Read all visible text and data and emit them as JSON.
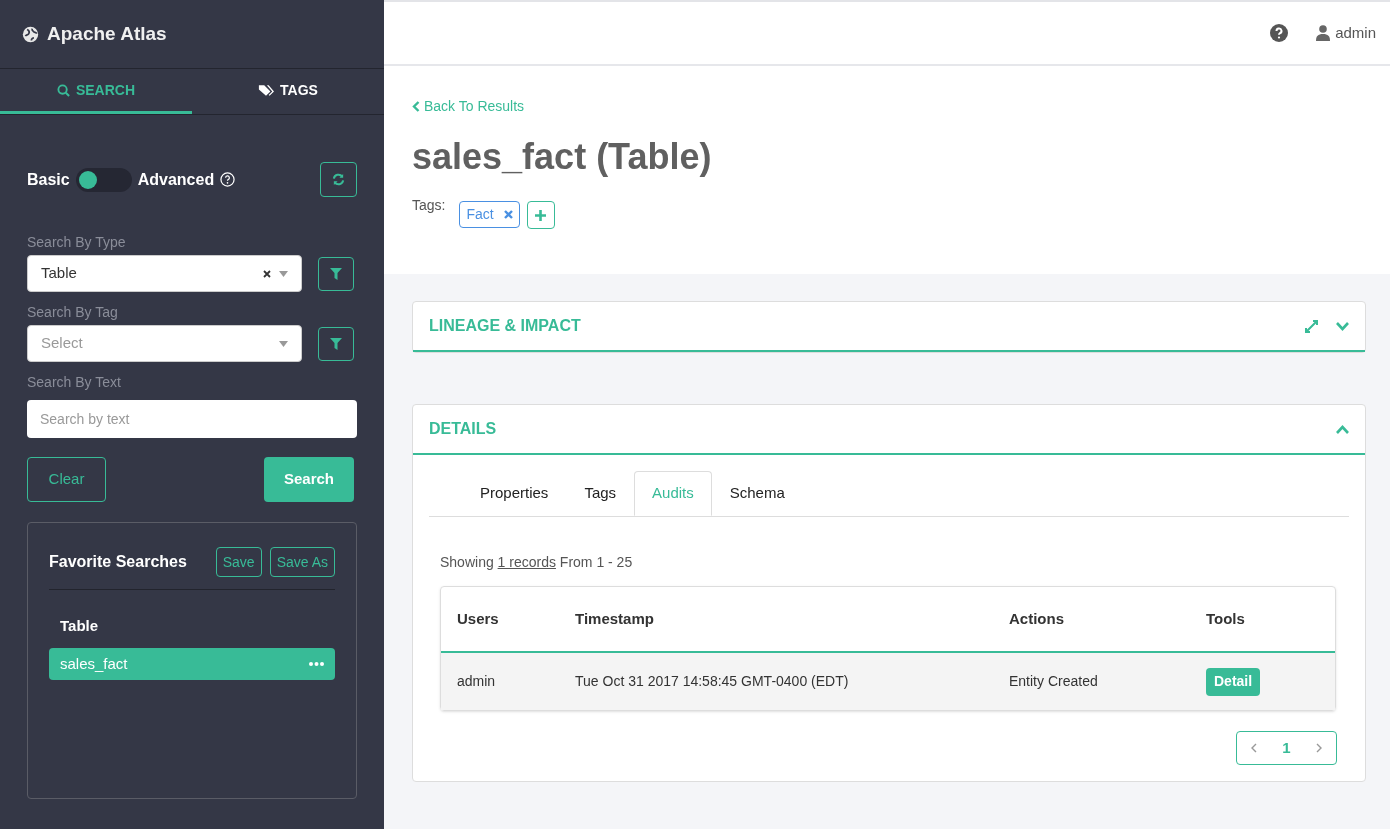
{
  "app": {
    "title": "Apache Atlas"
  },
  "side_tabs": [
    {
      "label": "SEARCH",
      "selected": true
    },
    {
      "label": "TAGS",
      "selected": false
    }
  ],
  "search_mode": {
    "left_label": "Basic",
    "right_label": "Advanced",
    "on": false
  },
  "search_by_type": {
    "label": "Search By Type",
    "value": "Table"
  },
  "search_by_tag": {
    "label": "Search By Tag",
    "placeholder": "Select"
  },
  "search_by_text": {
    "label": "Search By Text",
    "placeholder": "Search by text"
  },
  "actions": {
    "clear": "Clear",
    "search": "Search"
  },
  "favorites": {
    "title": "Favorite Searches",
    "buttons": [
      "Save",
      "Save As"
    ],
    "items": [
      {
        "label": "Table",
        "selected": false
      },
      {
        "label": "sales_fact",
        "selected": true
      }
    ]
  },
  "header": {
    "user": "admin"
  },
  "back_link": "Back To Results",
  "entity": {
    "title": "sales_fact (Table)",
    "tags_label": "Tags:",
    "tags": [
      "Fact"
    ]
  },
  "panels": [
    {
      "title": "LINEAGE & IMPACT",
      "expanded": false
    },
    {
      "title": "DETAILS",
      "expanded": true
    }
  ],
  "detail_tabs": [
    {
      "label": "Properties",
      "selected": false
    },
    {
      "label": "Tags",
      "selected": false
    },
    {
      "label": "Audits",
      "selected": true
    },
    {
      "label": "Schema",
      "selected": false
    }
  ],
  "audits": {
    "prefix": "Showing",
    "link": "1 records",
    "suffix": "From 1 - 25"
  },
  "table": {
    "columns": [
      "Users",
      "Timestamp",
      "Actions",
      "Tools"
    ],
    "rows": [
      {
        "cells": [
          "admin",
          "Tue Oct 31 2017 14:58:45 GMT-0400 (EDT)",
          "Entity Created"
        ],
        "tool": "Detail"
      }
    ]
  },
  "pagination": {
    "pages": [
      {
        "label": "1",
        "selected": true
      }
    ]
  }
}
